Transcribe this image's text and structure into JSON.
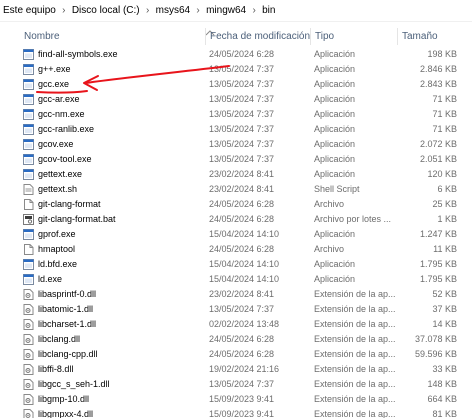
{
  "breadcrumb": [
    "Este equipo",
    "Disco local (C:)",
    "msys64",
    "mingw64",
    "bin"
  ],
  "columns": {
    "name": "Nombre",
    "date": "Fecha de modificación",
    "type": "Tipo",
    "size": "Tamaño"
  },
  "files": [
    {
      "name": "find-all-symbols.exe",
      "date": "24/05/2024 6:28",
      "type": "Aplicación",
      "size": "198 KB",
      "icon": "exe-icon"
    },
    {
      "name": "g++.exe",
      "date": "13/05/2024 7:37",
      "type": "Aplicación",
      "size": "2.846 KB",
      "icon": "exe-icon"
    },
    {
      "name": "gcc.exe",
      "date": "13/05/2024 7:37",
      "type": "Aplicación",
      "size": "2.843 KB",
      "icon": "exe-icon"
    },
    {
      "name": "gcc-ar.exe",
      "date": "13/05/2024 7:37",
      "type": "Aplicación",
      "size": "71 KB",
      "icon": "exe-icon"
    },
    {
      "name": "gcc-nm.exe",
      "date": "13/05/2024 7:37",
      "type": "Aplicación",
      "size": "71 KB",
      "icon": "exe-icon"
    },
    {
      "name": "gcc-ranlib.exe",
      "date": "13/05/2024 7:37",
      "type": "Aplicación",
      "size": "71 KB",
      "icon": "exe-icon"
    },
    {
      "name": "gcov.exe",
      "date": "13/05/2024 7:37",
      "type": "Aplicación",
      "size": "2.072 KB",
      "icon": "exe-icon"
    },
    {
      "name": "gcov-tool.exe",
      "date": "13/05/2024 7:37",
      "type": "Aplicación",
      "size": "2.051 KB",
      "icon": "exe-icon"
    },
    {
      "name": "gettext.exe",
      "date": "23/02/2024 8:41",
      "type": "Aplicación",
      "size": "120 KB",
      "icon": "exe-icon"
    },
    {
      "name": "gettext.sh",
      "date": "23/02/2024 8:41",
      "type": "Shell Script",
      "size": "6 KB",
      "icon": "script-icon"
    },
    {
      "name": "git-clang-format",
      "date": "24/05/2024 6:28",
      "type": "Archivo",
      "size": "25 KB",
      "icon": "file-icon"
    },
    {
      "name": "git-clang-format.bat",
      "date": "24/05/2024 6:28",
      "type": "Archivo por lotes ...",
      "size": "1 KB",
      "icon": "bat-icon"
    },
    {
      "name": "gprof.exe",
      "date": "15/04/2024 14:10",
      "type": "Aplicación",
      "size": "1.247 KB",
      "icon": "exe-icon"
    },
    {
      "name": "hmaptool",
      "date": "24/05/2024 6:28",
      "type": "Archivo",
      "size": "11 KB",
      "icon": "file-icon"
    },
    {
      "name": "ld.bfd.exe",
      "date": "15/04/2024 14:10",
      "type": "Aplicación",
      "size": "1.795 KB",
      "icon": "exe-icon"
    },
    {
      "name": "ld.exe",
      "date": "15/04/2024 14:10",
      "type": "Aplicación",
      "size": "1.795 KB",
      "icon": "exe-icon"
    },
    {
      "name": "libasprintf-0.dll",
      "date": "23/02/2024 8:41",
      "type": "Extensión de la ap...",
      "size": "52 KB",
      "icon": "dll-icon"
    },
    {
      "name": "libatomic-1.dll",
      "date": "13/05/2024 7:37",
      "type": "Extensión de la ap...",
      "size": "37 KB",
      "icon": "dll-icon"
    },
    {
      "name": "libcharset-1.dll",
      "date": "02/02/2024 13:48",
      "type": "Extensión de la ap...",
      "size": "14 KB",
      "icon": "dll-icon"
    },
    {
      "name": "libclang.dll",
      "date": "24/05/2024 6:28",
      "type": "Extensión de la ap...",
      "size": "37.078 KB",
      "icon": "dll-icon"
    },
    {
      "name": "libclang-cpp.dll",
      "date": "24/05/2024 6:28",
      "type": "Extensión de la ap...",
      "size": "59.596 KB",
      "icon": "dll-icon"
    },
    {
      "name": "libffi-8.dll",
      "date": "19/02/2024 21:16",
      "type": "Extensión de la ap...",
      "size": "33 KB",
      "icon": "dll-icon"
    },
    {
      "name": "libgcc_s_seh-1.dll",
      "date": "13/05/2024 7:37",
      "type": "Extensión de la ap...",
      "size": "148 KB",
      "icon": "dll-icon"
    },
    {
      "name": "libgmp-10.dll",
      "date": "15/09/2023 9:41",
      "type": "Extensión de la ap...",
      "size": "664 KB",
      "icon": "dll-icon"
    },
    {
      "name": "libgmpxx-4.dll",
      "date": "15/09/2023 9:41",
      "type": "Extensión de la ap...",
      "size": "81 KB",
      "icon": "dll-icon"
    }
  ],
  "colors": {
    "header_text": "#4c607a",
    "annotation": "#e8141b",
    "exe_blue": "#2b6cc4"
  }
}
